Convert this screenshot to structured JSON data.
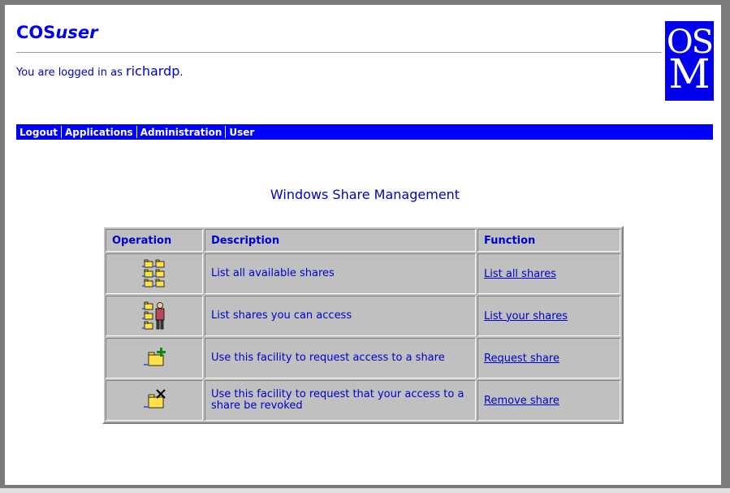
{
  "header": {
    "app_title_prefix": "COS",
    "app_title_suffix": "user",
    "login_prefix": "You are logged in as ",
    "username": "richardp",
    "login_suffix": ".",
    "logo_line1": "OS",
    "logo_line2": "M"
  },
  "nav": {
    "items": [
      {
        "label": "Logout"
      },
      {
        "label": "Applications"
      },
      {
        "label": "Administration"
      },
      {
        "label": "User"
      }
    ]
  },
  "main": {
    "heading": "Windows Share Management",
    "table": {
      "columns": [
        "Operation",
        "Description",
        "Function"
      ],
      "rows": [
        {
          "icon": "shares-list-icon",
          "description": "List all available shares",
          "function": "List all shares"
        },
        {
          "icon": "user-shares-icon",
          "description": "List shares you can access",
          "function": "List your shares"
        },
        {
          "icon": "request-share-icon",
          "description": "Use this facility to request access to a share",
          "function": "Request share"
        },
        {
          "icon": "remove-share-icon",
          "description": "Use this facility to request that your access to a share be revoked",
          "function": "Remove share"
        }
      ]
    }
  },
  "colors": {
    "accent_blue": "#0000ee",
    "nav_blue": "#0000ff",
    "table_bg": "#c0c0c0",
    "frame_gray": "#7b7b7b"
  }
}
